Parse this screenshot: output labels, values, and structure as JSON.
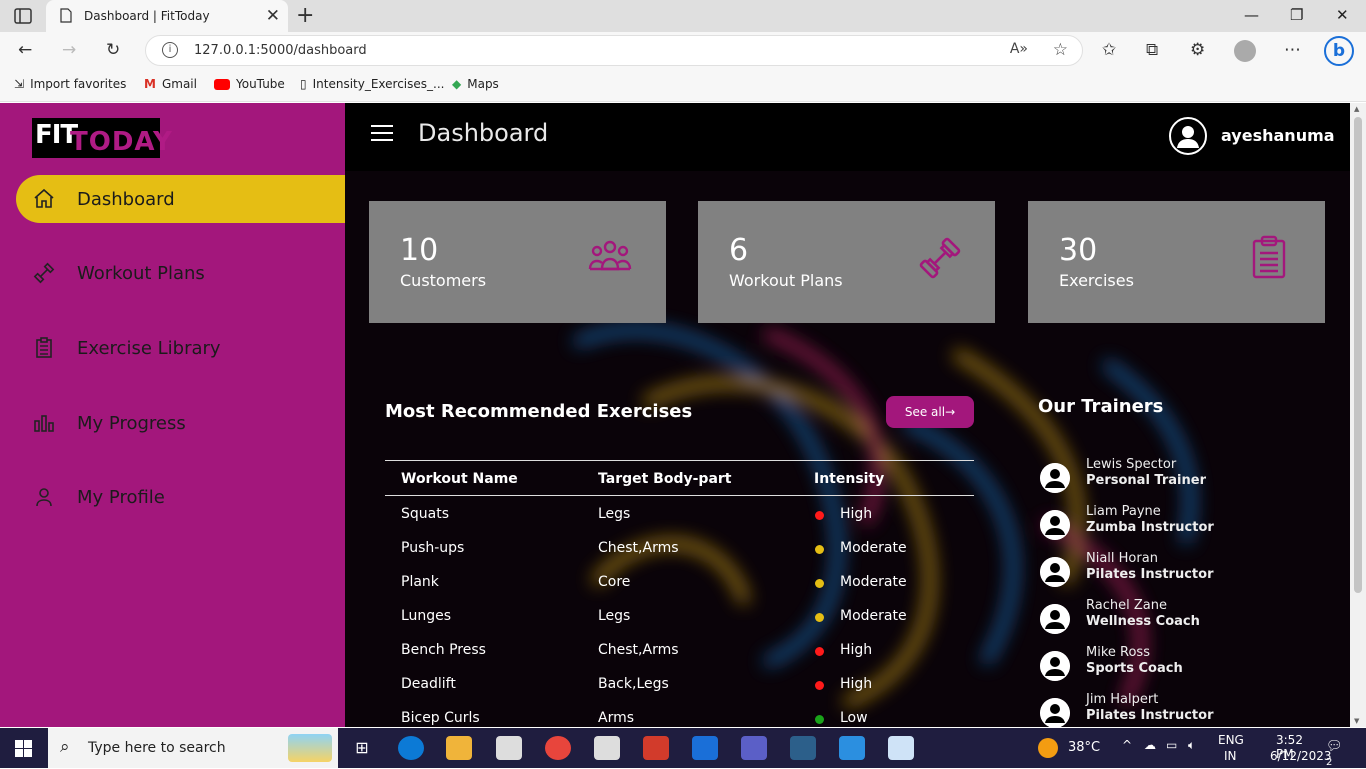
{
  "browser": {
    "tab_title": "Dashboard | FitToday",
    "url": "127.0.0.1:5000/dashboard",
    "favorites": [
      "Import favorites",
      "Gmail",
      "YouTube",
      "Intensity_Exercises_...",
      "Maps"
    ]
  },
  "sidebar": {
    "logo_fit": "FIT",
    "logo_today": "TODAY",
    "items": [
      {
        "label": "Dashboard",
        "icon": "home-icon",
        "active": true
      },
      {
        "label": "Workout Plans",
        "icon": "dumbbell-icon",
        "active": false
      },
      {
        "label": "Exercise Library",
        "icon": "clipboard-icon",
        "active": false
      },
      {
        "label": "My Progress",
        "icon": "bar-chart-icon",
        "active": false
      },
      {
        "label": "My Profile",
        "icon": "user-icon",
        "active": false
      }
    ]
  },
  "header": {
    "title": "Dashboard",
    "username": "ayeshanuma"
  },
  "cards": [
    {
      "value": "10",
      "label": "Customers",
      "icon": "users-icon"
    },
    {
      "value": "6",
      "label": "Workout Plans",
      "icon": "dumbbell-icon"
    },
    {
      "value": "30",
      "label": "Exercises",
      "icon": "clipboard-icon"
    }
  ],
  "exercises": {
    "title": "Most Recommended Exercises",
    "see_all": "See all",
    "columns": [
      "Workout Name",
      "Target Body-part",
      "Intensity"
    ],
    "rows": [
      {
        "name": "Squats",
        "target": "Legs",
        "intensity": "High",
        "color": "#ff1a1a"
      },
      {
        "name": "Push-ups",
        "target": "Chest,Arms",
        "intensity": "Moderate",
        "color": "#e5be14"
      },
      {
        "name": "Plank",
        "target": "Core",
        "intensity": "Moderate",
        "color": "#e5be14"
      },
      {
        "name": "Lunges",
        "target": "Legs",
        "intensity": "Moderate",
        "color": "#e5be14"
      },
      {
        "name": "Bench Press",
        "target": "Chest,Arms",
        "intensity": "High",
        "color": "#ff1a1a"
      },
      {
        "name": "Deadlift",
        "target": "Back,Legs",
        "intensity": "High",
        "color": "#ff1a1a"
      },
      {
        "name": "Bicep Curls",
        "target": "Arms",
        "intensity": "Low",
        "color": "#1aa31a"
      }
    ]
  },
  "trainers": {
    "title": "Our Trainers",
    "list": [
      {
        "name": "Lewis Spector",
        "role": "Personal Trainer"
      },
      {
        "name": "Liam Payne",
        "role": "Zumba Instructor"
      },
      {
        "name": "Niall Horan",
        "role": "Pilates Instructor"
      },
      {
        "name": "Rachel Zane",
        "role": "Wellness Coach"
      },
      {
        "name": "Mike Ross",
        "role": "Sports Coach"
      },
      {
        "name": "Jim Halpert",
        "role": "Pilates Instructor"
      }
    ]
  },
  "taskbar": {
    "search_placeholder": "Type here to search",
    "temperature": "38°C",
    "lang": "ENG",
    "region": "IN",
    "time": "3:52 PM",
    "date": "6/12/2023",
    "notifications": "2"
  },
  "colors": {
    "sidebar": "#a3177c",
    "active": "#e5be14",
    "card": "#818181"
  }
}
